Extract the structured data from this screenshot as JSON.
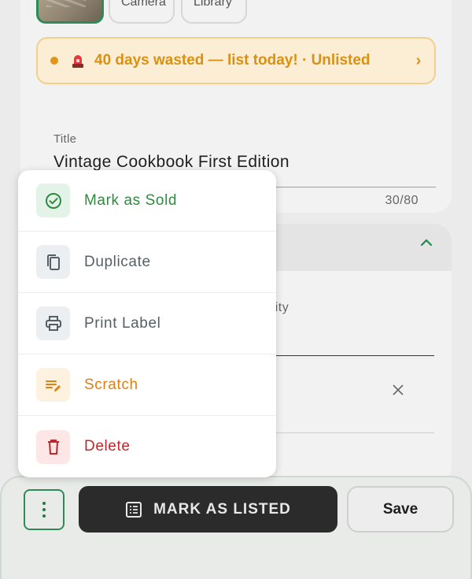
{
  "photo_sources": {
    "camera_label": "Camera",
    "library_label": "Library"
  },
  "alert": {
    "text": "40 days wasted — list today! · Unlisted",
    "icon": "siren-icon",
    "color": "#d99114"
  },
  "title_field": {
    "label": "Title",
    "value": "Vintage Cookbook First Edition",
    "counter": "30/80"
  },
  "quantity_field": {
    "label_partial": "antity"
  },
  "menu": {
    "items": [
      {
        "label": "Mark as Sold",
        "icon": "check-circle-icon",
        "color": "#2e8b3e"
      },
      {
        "label": "Duplicate",
        "icon": "copy-icon",
        "color": "#555f66"
      },
      {
        "label": "Print Label",
        "icon": "printer-icon",
        "color": "#555f66"
      },
      {
        "label": "Scratch",
        "icon": "edit-note-icon",
        "color": "#e07f12"
      },
      {
        "label": "Delete",
        "icon": "trash-icon",
        "color": "#c0272d"
      }
    ]
  },
  "bottom_bar": {
    "mark_listed_label": "MARK AS LISTED",
    "save_label": "Save"
  },
  "colors": {
    "accent_green": "#2e8b57",
    "dark_button": "#2b2b2b"
  }
}
